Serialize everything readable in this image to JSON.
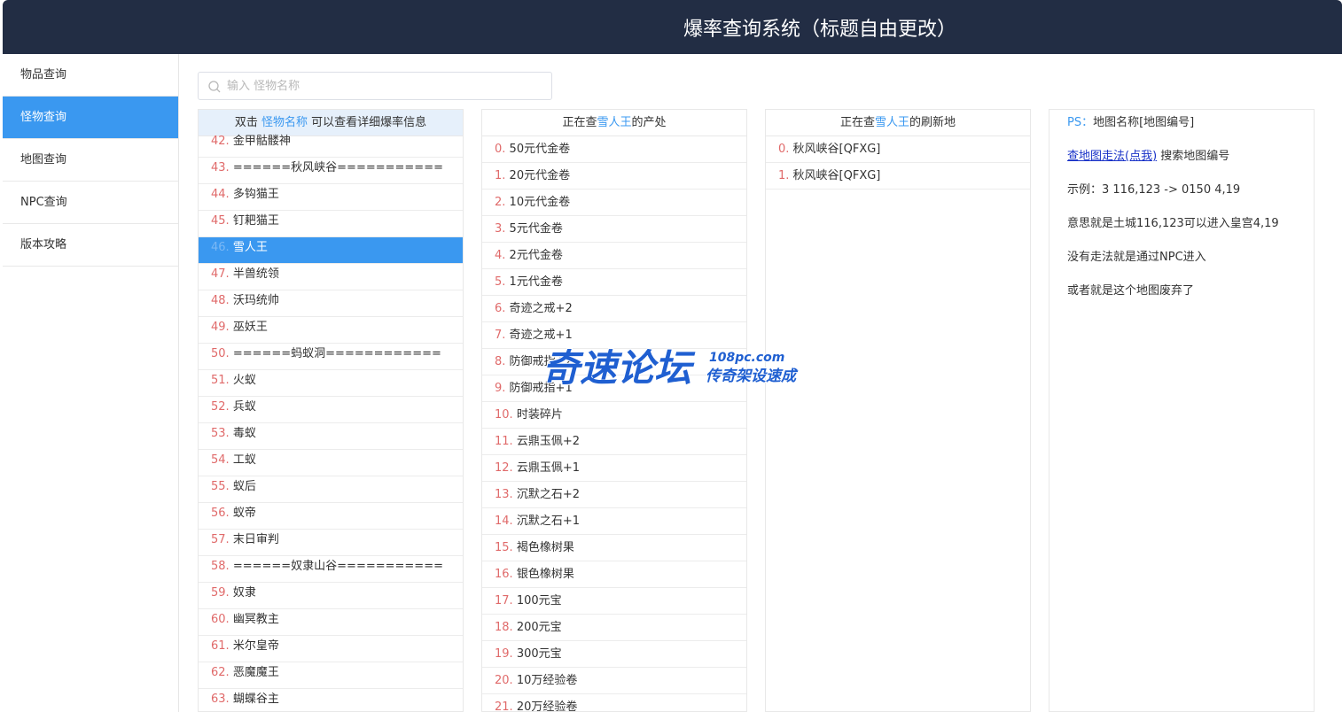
{
  "header": {
    "title": "爆率查询系统（标题自由更改）"
  },
  "sidebar": {
    "items": [
      {
        "label": "物品查询",
        "active": false
      },
      {
        "label": "怪物查询",
        "active": true
      },
      {
        "label": "地图查询",
        "active": false
      },
      {
        "label": "NPC查询",
        "active": false
      },
      {
        "label": "版本攻略",
        "active": false
      }
    ]
  },
  "search": {
    "placeholder": "输入 怪物名称",
    "value": ""
  },
  "monster_panel": {
    "head_prefix": "双击",
    "head_highlight": "怪物名称",
    "head_suffix": "可以查看详细爆率信息",
    "rows": [
      {
        "idx": "42",
        "name": "金甲骷髅神"
      },
      {
        "idx": "43",
        "name": "======秋风峡谷==========="
      },
      {
        "idx": "44",
        "name": "多钩猫王"
      },
      {
        "idx": "45",
        "name": "钉耙猫王"
      },
      {
        "idx": "46",
        "name": "雪人王",
        "selected": true
      },
      {
        "idx": "47",
        "name": "半兽统领"
      },
      {
        "idx": "48",
        "name": "沃玛统帅"
      },
      {
        "idx": "49",
        "name": "巫妖王"
      },
      {
        "idx": "50",
        "name": "======蚂蚁洞============"
      },
      {
        "idx": "51",
        "name": "火蚁"
      },
      {
        "idx": "52",
        "name": "兵蚁"
      },
      {
        "idx": "53",
        "name": "毒蚁"
      },
      {
        "idx": "54",
        "name": "工蚁"
      },
      {
        "idx": "55",
        "name": "蚁后"
      },
      {
        "idx": "56",
        "name": "蚁帝"
      },
      {
        "idx": "57",
        "name": "末日审判"
      },
      {
        "idx": "58",
        "name": "======奴隶山谷==========="
      },
      {
        "idx": "59",
        "name": "奴隶"
      },
      {
        "idx": "60",
        "name": "幽冥教主"
      },
      {
        "idx": "61",
        "name": "米尔皇帝"
      },
      {
        "idx": "62",
        "name": "恶魔魔王"
      },
      {
        "idx": "63",
        "name": "蝴蝶谷主"
      }
    ]
  },
  "drop_panel": {
    "head_prefix": "正在查",
    "head_highlight": "雪人王",
    "head_suffix": "的产处",
    "rows": [
      {
        "idx": "0",
        "name": "50元代金卷"
      },
      {
        "idx": "1",
        "name": "20元代金卷"
      },
      {
        "idx": "2",
        "name": "10元代金卷"
      },
      {
        "idx": "3",
        "name": "5元代金卷"
      },
      {
        "idx": "4",
        "name": "2元代金卷"
      },
      {
        "idx": "5",
        "name": "1元代金卷"
      },
      {
        "idx": "6",
        "name": "奇迹之戒+2"
      },
      {
        "idx": "7",
        "name": "奇迹之戒+1"
      },
      {
        "idx": "8",
        "name": "防御戒指+2"
      },
      {
        "idx": "9",
        "name": "防御戒指+1"
      },
      {
        "idx": "10",
        "name": "时装碎片"
      },
      {
        "idx": "11",
        "name": "云鼎玉佩+2"
      },
      {
        "idx": "12",
        "name": "云鼎玉佩+1"
      },
      {
        "idx": "13",
        "name": "沉默之石+2"
      },
      {
        "idx": "14",
        "name": "沉默之石+1"
      },
      {
        "idx": "15",
        "name": "褐色橡树果"
      },
      {
        "idx": "16",
        "name": "银色橡树果"
      },
      {
        "idx": "17",
        "name": "100元宝"
      },
      {
        "idx": "18",
        "name": "200元宝"
      },
      {
        "idx": "19",
        "name": "300元宝"
      },
      {
        "idx": "20",
        "name": "10万经验卷"
      },
      {
        "idx": "21",
        "name": "20万经验卷"
      }
    ]
  },
  "refresh_panel": {
    "head_prefix": "正在查",
    "head_highlight": "雪人王",
    "head_suffix": "的刷新地",
    "rows": [
      {
        "idx": "0",
        "name": "秋风峡谷[QFXG]"
      },
      {
        "idx": "1",
        "name": "秋风峡谷[QFXG]"
      }
    ]
  },
  "info_panel": {
    "ps_label": "PS：",
    "ps_text": "地图名称[地图编号]",
    "link_text": "查地图走法(点我)",
    "link_suffix": "搜索地图编号",
    "lines": [
      "示例：3 116,123 -> 0150 4,19",
      "意思就是土城116,123可以进入皇宫4,19",
      "没有走法就是通过NPC进入",
      "或者就是这个地图废弃了"
    ]
  },
  "watermark": {
    "main": "奇速论坛",
    "url": "108pc.com",
    "sub": "传奇架设速成"
  },
  "colors": {
    "header_bg": "#222d44",
    "accent": "#3a98f0",
    "index": "#e06a6a",
    "link": "#1a33c8"
  }
}
